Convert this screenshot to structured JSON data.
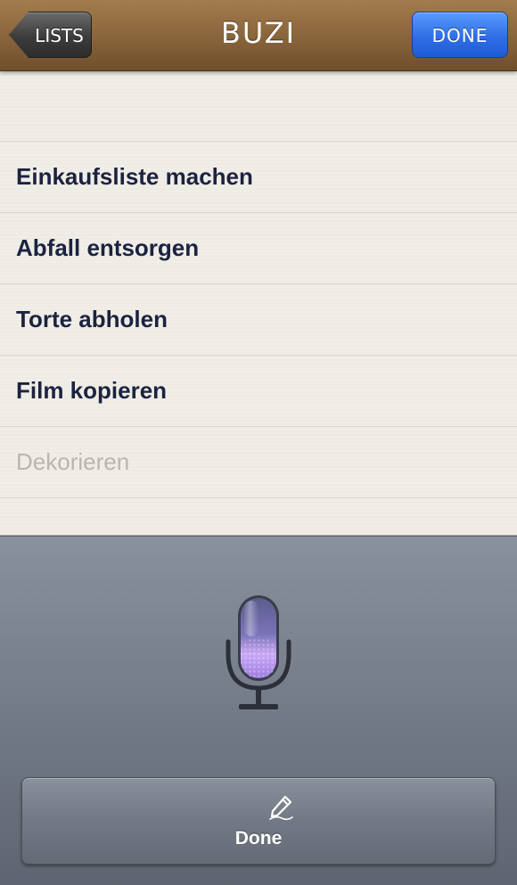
{
  "navbar": {
    "title": "BUZI",
    "back_label": "LISTS",
    "done_label": "DONE"
  },
  "list": {
    "items": [
      {
        "label": "Einkaufsliste machen"
      },
      {
        "label": "Abfall entsorgen"
      },
      {
        "label": "Torte abholen"
      },
      {
        "label": "Film kopieren"
      }
    ],
    "new_item_placeholder": "Dekorieren"
  },
  "dictation": {
    "mic_icon": "microphone-icon",
    "done_icon": "pencil-icon",
    "done_label": "Done"
  },
  "colors": {
    "navbar": "#8b663c",
    "done_blue": "#2f6fe6",
    "item_text": "#1c2340",
    "paper": "#f0eee7"
  }
}
